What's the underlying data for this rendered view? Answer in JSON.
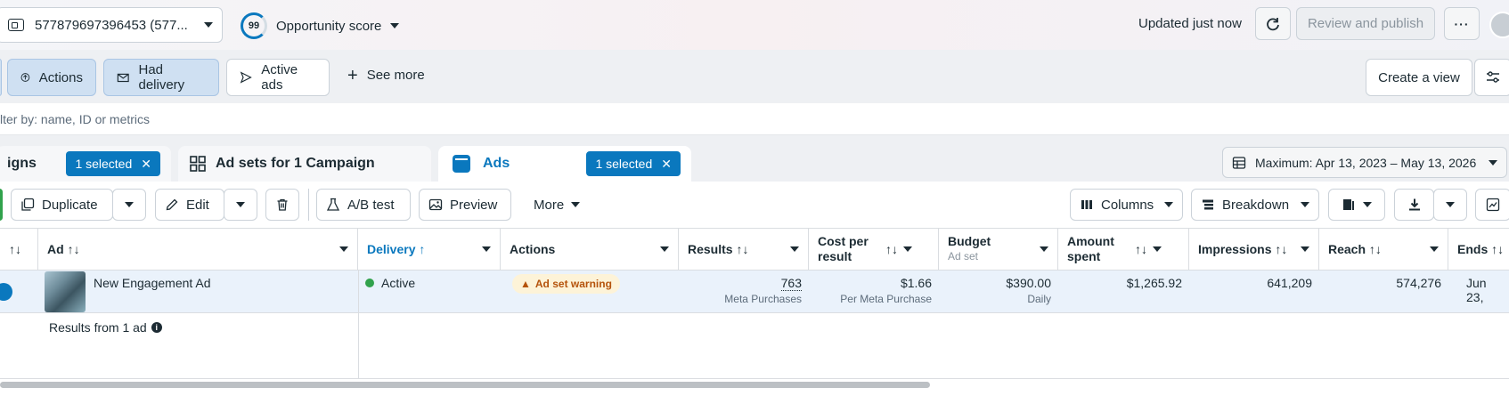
{
  "topbar": {
    "account": "577879697396453 (577...",
    "score_value": "99",
    "score_label": "Opportunity score",
    "updated": "Updated just now",
    "review_publish": "Review and publish"
  },
  "filters": {
    "actions": "Actions",
    "had_delivery": "Had delivery",
    "active_ads": "Active ads",
    "see_more": "See more",
    "create_view": "Create a view",
    "search_placeholder": "lter by: name, ID or metrics"
  },
  "tabs": {
    "campaigns": "igns",
    "campaigns_selected": "1 selected",
    "adsets": "Ad sets for 1 Campaign",
    "ads": "Ads",
    "ads_selected": "1 selected",
    "date_range": "Maximum: Apr 13, 2023 – May 13, 2026"
  },
  "toolbar": {
    "duplicate": "Duplicate",
    "edit": "Edit",
    "ab_test": "A/B test",
    "preview": "Preview",
    "more": "More",
    "columns": "Columns",
    "breakdown": "Breakdown"
  },
  "table": {
    "headers": {
      "ad": "Ad",
      "delivery": "Delivery",
      "actions": "Actions",
      "results": "Results",
      "cost_per_result": "Cost per result",
      "budget": "Budget",
      "budget_sub": "Ad set",
      "amount_spent": "Amount spent",
      "impressions": "Impressions",
      "reach": "Reach",
      "ends": "Ends"
    },
    "row": {
      "ad_name": "New Engagement Ad",
      "delivery": "Active",
      "warning": "Ad set warning",
      "results": "763",
      "results_sub": "Meta Purchases",
      "cost": "$1.66",
      "cost_sub": "Per Meta Purchase",
      "budget": "$390.00",
      "budget_sub": "Daily",
      "spent": "$1,265.92",
      "impressions": "641,209",
      "reach": "574,276",
      "ends": "Jun 23,"
    },
    "footer": "Results from 1 ad"
  },
  "colors": {
    "accent": "#0a78be",
    "active": "#31a24c",
    "warning": "#b5530c"
  }
}
